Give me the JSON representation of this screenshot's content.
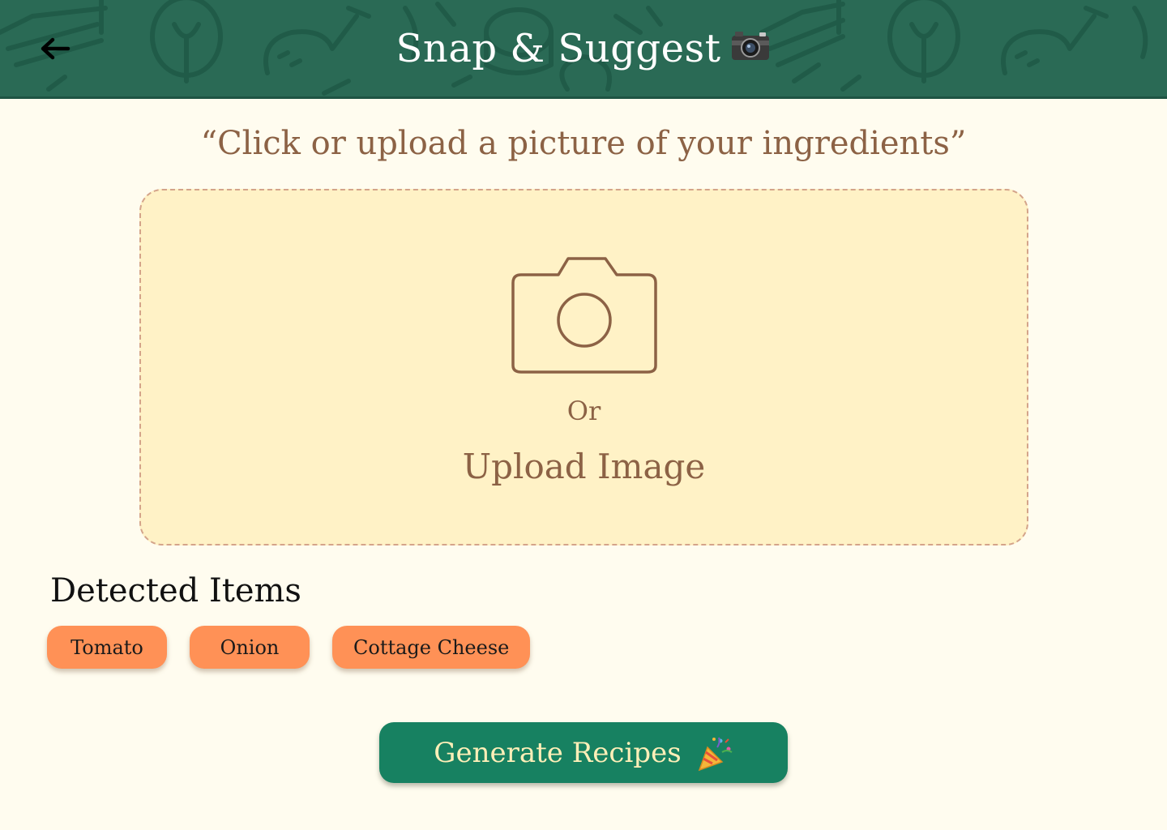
{
  "header": {
    "title": "Snap & Suggest",
    "back_icon": "arrow-left-icon",
    "title_icon": "camera-emoji-icon",
    "background_color": "#2A6A55"
  },
  "instruction": "“Click or upload a picture of your ingredients”",
  "upload": {
    "icon": "camera-icon",
    "or_label": "Or",
    "upload_label": "Upload Image",
    "background_color": "#FFF2C6"
  },
  "detected": {
    "heading": "Detected Items",
    "items": [
      "Tomato",
      "Onion",
      "Cottage Cheese"
    ],
    "chip_color": "#FF9156"
  },
  "actions": {
    "generate_label": "Generate Recipes",
    "generate_icon": "party-popper-icon",
    "button_color": "#178161"
  }
}
